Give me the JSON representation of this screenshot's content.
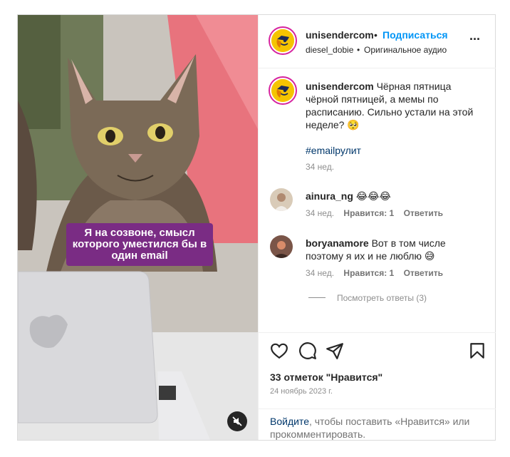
{
  "post": {
    "author": "unisendercom",
    "follow_label": "Подписаться",
    "dot": "•",
    "audio_author": "diesel_dobie",
    "audio_sep": "•",
    "audio_title": "Оригинальное аудио",
    "more_label": "···",
    "video_overlay_text": "Я на созвоне, смысл которого уместился бы в один email"
  },
  "caption": {
    "author": "unisendercom",
    "text": "Чёрная пятница чёрной пятницей, а мемы по расписанию. Сильно устали на этой неделе? 🥺",
    "hashtag": "#emailрулит",
    "age": "34 нед."
  },
  "comments": [
    {
      "author": "ainura_ng",
      "text": "😂😂😂",
      "age": "34 нед.",
      "likes": "Нравится: 1",
      "reply": "Ответить"
    },
    {
      "author": "boryanamore",
      "text": "Вот в том числе поэтому я их и не люблю 😅",
      "age": "34 нед.",
      "likes": "Нравится: 1",
      "reply": "Ответить"
    }
  ],
  "view_replies": "Посмотреть ответы (3)",
  "likes_count": "33 отметок \"Нравится\"",
  "date": "24 ноябрь 2023 г.",
  "footer": {
    "login": "Войдите",
    "rest": ", чтобы поставить «Нравится» или прокомментировать."
  },
  "colors": {
    "accent_blue": "#0095f6",
    "overlay_purple": "#7a2c84",
    "avatar_yellow": "#f5c400"
  },
  "icons": [
    "heart-icon",
    "comment-icon",
    "share-icon",
    "bookmark-icon",
    "mute-icon",
    "more-icon"
  ]
}
